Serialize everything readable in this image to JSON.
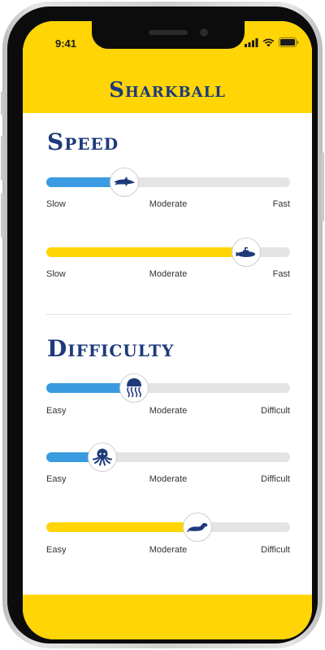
{
  "status_bar": {
    "time": "9:41"
  },
  "app": {
    "title": "Sharkball"
  },
  "colors": {
    "brand_yellow": "#ffd505",
    "accent_blue": "#3b9be0",
    "navy": "#1e3a7b",
    "track": "#e4e4e4"
  },
  "sections": [
    {
      "title": "Speed",
      "sliders": [
        {
          "icon": "shark-icon",
          "fill_color": "#3b9be0",
          "value_percent": 32,
          "labels": [
            "Slow",
            "Moderate",
            "Fast"
          ]
        },
        {
          "icon": "submarine-icon",
          "fill_color": "#ffd505",
          "value_percent": 82,
          "labels": [
            "Slow",
            "Moderate",
            "Fast"
          ]
        }
      ]
    },
    {
      "title": "Difficulty",
      "sliders": [
        {
          "icon": "jellyfish-icon",
          "fill_color": "#3b9be0",
          "value_percent": 36,
          "labels": [
            "Easy",
            "Moderate",
            "Difficult"
          ]
        },
        {
          "icon": "octopus-icon",
          "fill_color": "#3b9be0",
          "value_percent": 23,
          "labels": [
            "Easy",
            "Moderate",
            "Difficult"
          ]
        },
        {
          "icon": "otter-icon",
          "fill_color": "#ffd505",
          "value_percent": 62,
          "labels": [
            "Easy",
            "Moderate",
            "Difficult"
          ]
        }
      ]
    }
  ]
}
